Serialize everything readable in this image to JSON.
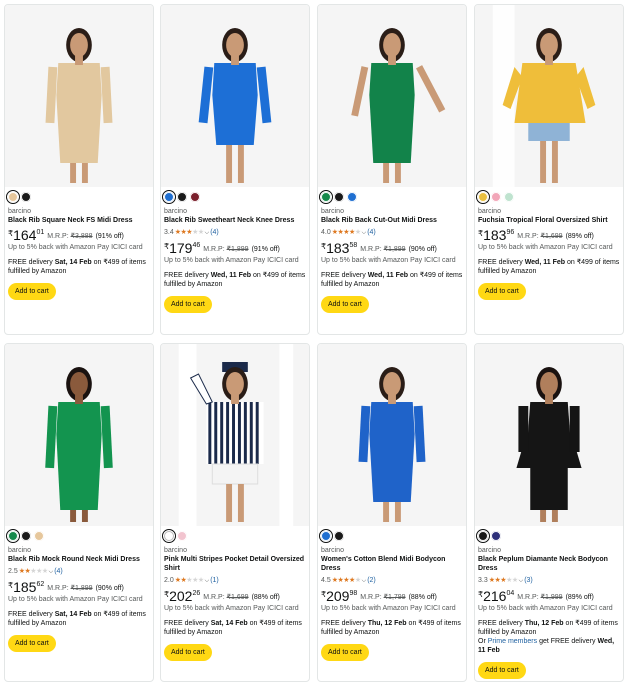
{
  "colors": {
    "star": "#de7921",
    "cart_button": "#ffd814",
    "link": "#2162a1"
  },
  "products": [
    {
      "swatches": [
        {
          "color": "#e6c79c",
          "selected": true
        },
        {
          "color": "#1a1a1a",
          "selected": false
        }
      ],
      "brand": "barcino",
      "title": "Black Rib Square Neck FS Midi Dress",
      "rating": null,
      "stars": 0,
      "reviews": null,
      "price_whole": "164",
      "price_frac": "01",
      "mrp_label": "M.R.P:",
      "mrp": "₹3,888",
      "discount": "(91% off)",
      "cashback": "Up to 5% back with Amazon Pay ICICI card",
      "delivery_prefix": "FREE delivery",
      "delivery_date": "Sat, 14 Feb",
      "delivery_suffix": "on ₹499 of items fulfilled by Amazon",
      "prime_note": null,
      "add_to_cart": "Add to cart",
      "image": {
        "dress": "#e2c89f",
        "skin": "#c99a76",
        "hair": "#2a1d17",
        "bg": "#f5f5f5",
        "style": "midi"
      }
    },
    {
      "swatches": [
        {
          "color": "#1f6fd1",
          "selected": true
        },
        {
          "color": "#1a1a1a",
          "selected": false
        },
        {
          "color": "#7a1f2b",
          "selected": false
        }
      ],
      "brand": "barcino",
      "title": "Black Rib Sweetheart Neck Knee Dress",
      "rating": "3.4",
      "stars": 3.4,
      "reviews": "(4)",
      "price_whole": "179",
      "price_frac": "46",
      "mrp_label": "M.R.P:",
      "mrp": "₹1,899",
      "discount": "(91% off)",
      "cashback": "Up to 5% back with Amazon Pay ICICI card",
      "delivery_prefix": "FREE delivery",
      "delivery_date": "Wed, 11 Feb",
      "delivery_suffix": "on ₹499 of items fulfilled by Amazon",
      "prime_note": null,
      "add_to_cart": "Add to cart",
      "image": {
        "dress": "#1d6fd6",
        "skin": "#c99a76",
        "hair": "#2a1d17",
        "bg": "#f5f5f5",
        "style": "knee"
      }
    },
    {
      "swatches": [
        {
          "color": "#168a4c",
          "selected": true
        },
        {
          "color": "#1a1a1a",
          "selected": false
        },
        {
          "color": "#1f6fd1",
          "selected": false
        }
      ],
      "brand": "barcino",
      "title": "Black Rib Back Cut-Out Midi Dress",
      "rating": "4.0",
      "stars": 4.0,
      "reviews": "(4)",
      "price_whole": "183",
      "price_frac": "58",
      "mrp_label": "M.R.P:",
      "mrp": "₹1,899",
      "discount": "(90% off)",
      "cashback": "Up to 5% back with Amazon Pay ICICI card",
      "delivery_prefix": "FREE delivery",
      "delivery_date": "Wed, 11 Feb",
      "delivery_suffix": "on ₹499 of items fulfilled by Amazon",
      "prime_note": null,
      "add_to_cart": "Add to cart",
      "image": {
        "dress": "#12834a",
        "skin": "#c99a76",
        "hair": "#2a1d17",
        "bg": "#f5f5f5",
        "style": "sleeveless"
      }
    },
    {
      "swatches": [
        {
          "color": "#e9c040",
          "selected": true
        },
        {
          "color": "#f2a6b8",
          "selected": false
        },
        {
          "color": "#bfe3cf",
          "selected": false
        }
      ],
      "brand": "barcino",
      "title": "Fuchsia Tropical Floral Oversized Shirt",
      "rating": null,
      "stars": 0,
      "reviews": null,
      "price_whole": "183",
      "price_frac": "96",
      "mrp_label": "M.R.P:",
      "mrp": "₹1,699",
      "discount": "(89% off)",
      "cashback": "Up to 5% back with Amazon Pay ICICI card",
      "delivery_prefix": "FREE delivery",
      "delivery_date": "Wed, 11 Feb",
      "delivery_suffix": "on ₹499 of items fulfilled by Amazon",
      "prime_note": null,
      "add_to_cart": "Add to cart",
      "image": {
        "dress": "#efbe3a",
        "skin": "#c99a76",
        "hair": "#2a1d17",
        "bg": "#f5f5f5",
        "style": "shirt"
      }
    },
    {
      "swatches": [
        {
          "color": "#168a4c",
          "selected": true
        },
        {
          "color": "#1a1a1a",
          "selected": false
        },
        {
          "color": "#e6c79c",
          "selected": false
        }
      ],
      "brand": "barcino",
      "title": "Black Rib Mock Round Neck Midi Dress",
      "rating": "2.5",
      "stars": 2.5,
      "reviews": "(4)",
      "price_whole": "185",
      "price_frac": "62",
      "mrp_label": "M.R.P:",
      "mrp": "₹1,899",
      "discount": "(90% off)",
      "cashback": "Up to 5% back with Amazon Pay ICICI card",
      "delivery_prefix": "FREE delivery",
      "delivery_date": "Sat, 14 Feb",
      "delivery_suffix": "on ₹499 of items fulfilled by Amazon",
      "prime_note": null,
      "add_to_cart": "Add to cart",
      "image": {
        "dress": "#13944f",
        "skin": "#8a5a3c",
        "hair": "#1a1210",
        "bg": "#f5f5f5",
        "style": "long"
      }
    },
    {
      "swatches": [
        {
          "color": "#ffffff",
          "selected": true
        },
        {
          "color": "#f2c4cf",
          "selected": false
        }
      ],
      "brand": "barcino",
      "title": "Pink Multi Stripes Pocket Detail Oversized Shirt",
      "rating": "2.0",
      "stars": 2.0,
      "reviews": "(1)",
      "price_whole": "202",
      "price_frac": "26",
      "mrp_label": "M.R.P:",
      "mrp": "₹1,699",
      "discount": "(88% off)",
      "cashback": "Up to 5% back with Amazon Pay ICICI card",
      "delivery_prefix": "FREE delivery",
      "delivery_date": "Sat, 14 Feb",
      "delivery_suffix": "on ₹499 of items fulfilled by Amazon",
      "prime_note": null,
      "add_to_cart": "Add to cart",
      "image": {
        "dress": "#1b2a4a",
        "skin": "#c99a76",
        "hair": "#2a1d17",
        "bg": "#f5f5f5",
        "style": "stripe"
      }
    },
    {
      "swatches": [
        {
          "color": "#1f6fd1",
          "selected": true
        },
        {
          "color": "#1a1a1a",
          "selected": false
        }
      ],
      "brand": "barcino",
      "title": "Women's Cotton Blend Midi Bodycon Dress",
      "rating": "4.5",
      "stars": 4.5,
      "reviews": "(2)",
      "price_whole": "209",
      "price_frac": "98",
      "mrp_label": "M.R.P:",
      "mrp": "₹1,799",
      "discount": "(88% off)",
      "cashback": "Up to 5% back with Amazon Pay ICICI card",
      "delivery_prefix": "FREE delivery",
      "delivery_date": "Thu, 12 Feb",
      "delivery_suffix": "on ₹499 of items fulfilled by Amazon",
      "prime_note": null,
      "add_to_cart": "Add to cart",
      "image": {
        "dress": "#1f63c9",
        "skin": "#c99a76",
        "hair": "#2a1d17",
        "bg": "#f5f5f5",
        "style": "wrap"
      }
    },
    {
      "swatches": [
        {
          "color": "#1a1a1a",
          "selected": true
        },
        {
          "color": "#2d2f7a",
          "selected": false
        }
      ],
      "brand": "barcino",
      "title": "Black Peplum Diamante Neck Bodycon Dress",
      "rating": "3.3",
      "stars": 3.3,
      "reviews": "(3)",
      "price_whole": "216",
      "price_frac": "04",
      "mrp_label": "M.R.P:",
      "mrp": "₹1,999",
      "discount": "(89% off)",
      "cashback": "Up to 5% back with Amazon Pay ICICI card",
      "delivery_prefix": "FREE delivery",
      "delivery_date": "Thu, 12 Feb",
      "delivery_suffix": "on ₹499 of items fulfilled by Amazon",
      "prime_note": {
        "pre": "Or",
        "link": "Prime members",
        "mid": "get FREE delivery",
        "date": "Wed, 11 Feb"
      },
      "add_to_cart": "Add to cart",
      "image": {
        "dress": "#151515",
        "skin": "#b07f5c",
        "hair": "#1a1210",
        "bg": "#f5f5f5",
        "style": "peplum"
      }
    }
  ]
}
